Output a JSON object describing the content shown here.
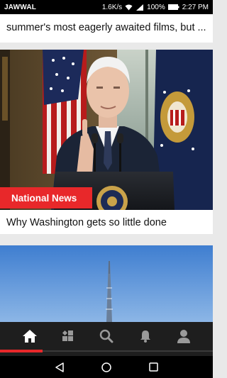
{
  "status_bar": {
    "carrier": "JAWWAL",
    "net_speed": "1.6K/s",
    "battery": "100%",
    "time": "2:27 PM"
  },
  "feed": {
    "top_card_title": "summer's most eagerly awaited films, but ...",
    "article": {
      "category": "National News",
      "title": "Why Washington gets so little done"
    }
  },
  "bottom_nav": {
    "items": [
      "home-icon",
      "categories-icon",
      "search-icon",
      "notifications-icon",
      "profile-icon"
    ],
    "active": "home-icon"
  },
  "colors": {
    "accent": "#e8282a",
    "nav_bg": "#1e1e1e"
  }
}
